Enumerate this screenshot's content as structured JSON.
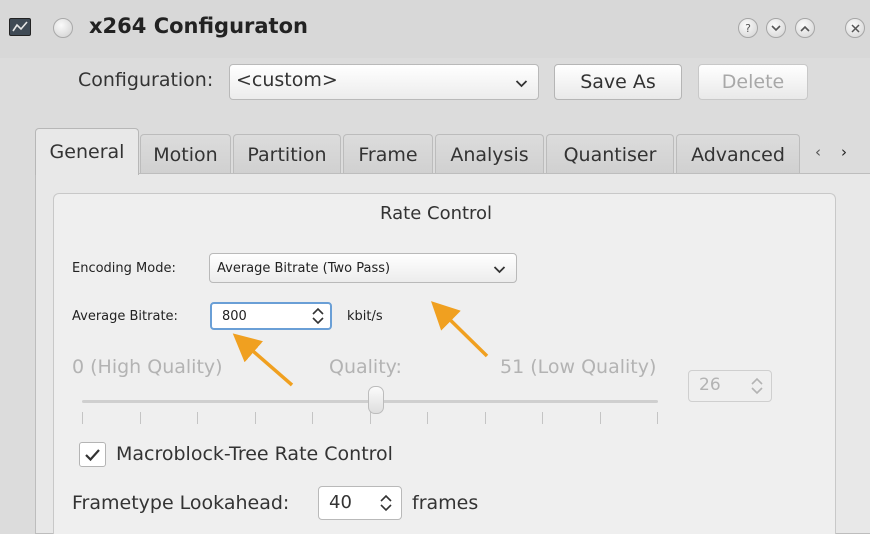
{
  "window": {
    "title": "x264 Configuraton",
    "controls": [
      "help-icon",
      "minimize-icon",
      "maximize-icon",
      "close-icon"
    ]
  },
  "config": {
    "label": "Configuration:",
    "value": "<custom>",
    "save_as": "Save As",
    "delete": "Delete"
  },
  "tabs": [
    "General",
    "Motion",
    "Partition",
    "Frame",
    "Analysis",
    "Quantiser",
    "Advanced"
  ],
  "active_tab": "General",
  "rate_control": {
    "title": "Rate Control",
    "encoding_mode_label": "Encoding Mode:",
    "encoding_mode_value": "Average Bitrate (Two Pass)",
    "avg_bitrate_label": "Average Bitrate:",
    "avg_bitrate_value": "800",
    "avg_bitrate_unit": "kbit/s",
    "quality_low_label": "0 (High Quality)",
    "quality_label": "Quality:",
    "quality_high_label": "51 (Low Quality)",
    "quality_value": "26",
    "quality_fraction": 0.51,
    "mbtree_label": "Macroblock-Tree Rate Control",
    "mbtree_checked": true,
    "lookahead_label": "Frametype Lookahead:",
    "lookahead_value": "40",
    "lookahead_unit": "frames"
  },
  "colors": {
    "annotation_arrow": "#f0a020",
    "focus": "#6a9fd6"
  }
}
